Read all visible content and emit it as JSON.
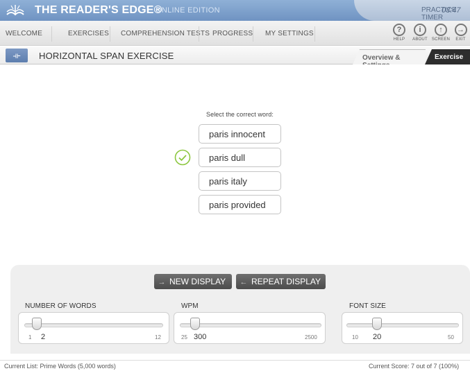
{
  "app": {
    "brand": "THE READER'S EDGE®",
    "edition": "ONLINE EDITION",
    "practice_timer_label": "PRACTICE TIMER",
    "practice_timer_value": "03:47"
  },
  "nav": {
    "items": [
      "WELCOME",
      "EXERCISES",
      "COMPREHENSION TESTS",
      "PROGRESS",
      "MY SETTINGS"
    ],
    "tools": [
      {
        "label": "HELP",
        "icon": "help-icon",
        "glyph": "?"
      },
      {
        "label": "ABOUT",
        "icon": "info-icon",
        "glyph": "i"
      },
      {
        "label": "SCREEN",
        "icon": "screen-icon",
        "glyph": "↑"
      },
      {
        "label": "EXIT",
        "icon": "exit-icon",
        "glyph": "→"
      }
    ]
  },
  "page": {
    "title": "HORIZONTAL SPAN EXERCISE",
    "tabs": [
      {
        "label": "Overview & Settings",
        "active": false
      },
      {
        "label": "Exercise",
        "active": true
      }
    ]
  },
  "exercise": {
    "prompt": "Select the correct word:",
    "options": [
      "paris innocent",
      "paris dull",
      "paris italy",
      "paris provided"
    ],
    "checked_option_index": 1
  },
  "controls": {
    "new_display": "NEW DISPLAY",
    "repeat_display": "REPEAT DISPLAY",
    "sliders": [
      {
        "label": "NUMBER OF WORDS",
        "min": "1",
        "max": "12",
        "value": "2",
        "position": 0.09
      },
      {
        "label": "WPM",
        "min": "25",
        "max": "2500",
        "value": "300",
        "position": 0.11
      },
      {
        "label": "FONT SIZE",
        "min": "10",
        "max": "50",
        "value": "20",
        "position": 0.27
      }
    ]
  },
  "status": {
    "current_list": "Current List: Prime Words (5,000 words)",
    "current_score": "Current Score: 7 out of 7  (100%)"
  },
  "colors": {
    "topbar": "#7a9bc9",
    "check": "#8cc63f",
    "button_dark": "#555555",
    "tab_active": "#2d2d2d"
  }
}
